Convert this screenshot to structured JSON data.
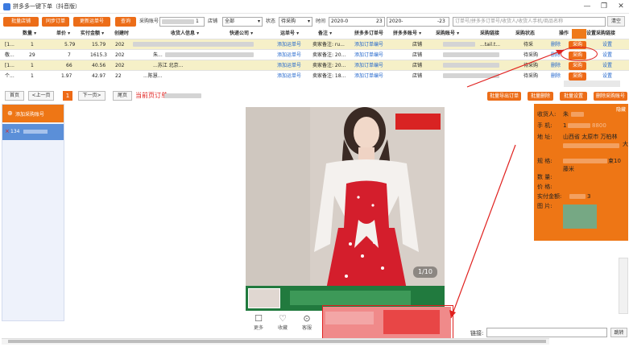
{
  "window": {
    "title": "拼多多一键下单（抖音版）",
    "min": "—",
    "max": "❐",
    "close": "✕"
  },
  "toolbar": {
    "btn1": "批量店铺",
    "btn2": "同步订单",
    "btn3": "更新运单号",
    "btn4": "查询",
    "purchase_account_label": "采购账号",
    "purchase_account_value": "1",
    "shop_label": "店铺",
    "shop_value": "全部",
    "status_label": "状态",
    "status_value": "待采购",
    "time_label": "时间",
    "date_from": "2020-0",
    "date_to_prefix": "23",
    "date_to": "2020-",
    "date_to_suffix": "-23",
    "search_placeholder": "订单号/拼多多订单号/收货人/收货人手机/商品名称",
    "clear_label": "清空",
    "search_label": "搜"
  },
  "table": {
    "headers": [
      "数量 ▾",
      "单价 ▾",
      "实付金额 ▾",
      "创建时",
      "收货人信息 ▾",
      "快递公司 ▾",
      "运单号 ▾",
      "备注 ▾",
      "拼多多订单号",
      "拼多多账号 ▾",
      "采购账号 ▾",
      "采购链接",
      "采购状态",
      "操作",
      "设置采购链接"
    ],
    "rows": [
      {
        "first": "[1...",
        "qty": "1",
        "unit": "5.79",
        "paid": "15.79",
        "created": "202",
        "receiver": "",
        "company": "",
        "waybill": "添加运单号",
        "note": "卖家备注: ru...",
        "pdd": "添加订单编号",
        "pdd_account": "店铺",
        "purchase_account": "",
        "link": "...tail.t...",
        "state": "待采",
        "op_del": "删除",
        "op_buy": "采购",
        "setting": "设置"
      },
      {
        "first": "敬...",
        "qty": "29",
        "unit": "7",
        "paid": "1615.3",
        "created": "202",
        "receiver": "朱...",
        "company": "",
        "waybill": "添加运单号",
        "note": "卖家备注: 20...",
        "pdd": "添加订单编号",
        "pdd_account": "店铺",
        "purchase_account": "",
        "link": "",
        "state": "待采购",
        "op_del": "删除",
        "op_buy": "采购",
        "setting": "设置"
      },
      {
        "first": "[1...",
        "qty": "1",
        "unit": "66",
        "paid": "40.56",
        "created": "202",
        "receiver": "...苏江 北京...",
        "company": "",
        "waybill": "添加运单号",
        "note": "卖家备注: 20...",
        "pdd": "添加订单编号",
        "pdd_account": "店铺",
        "purchase_account": "",
        "link": "",
        "state": "待采购",
        "op_del": "删除",
        "op_buy": "采购",
        "setting": "设置"
      },
      {
        "first": "个...",
        "qty": "1",
        "unit": "1.97",
        "paid": "42.97",
        "created": "22",
        "receiver": "...陈慧...",
        "company": "",
        "waybill": "添加运单号",
        "note": "卖家备注: 18...",
        "pdd": "添加订单编号",
        "pdd_account": "店铺",
        "purchase_account": "",
        "link": "",
        "state": "待采购",
        "op_del": "删除",
        "op_buy": "采购",
        "setting": "设置"
      }
    ]
  },
  "pager": {
    "first": "首页",
    "prev": "<上一页",
    "current": "1",
    "next": "下一页>",
    "last": "尾页",
    "page_note": "当前页订单",
    "right_btns": [
      "批量导出订单",
      "批量删除",
      "批量设置",
      "删除采购账号"
    ]
  },
  "left": {
    "add_label": "添加采购账号",
    "account": "134"
  },
  "product": {
    "counter": "1/10",
    "more": "更多",
    "fav": "收藏",
    "service": "客服"
  },
  "details": {
    "close": "隐藏",
    "receiver_label": "收货人:",
    "receiver_value": "朱",
    "phone_label": "手  机:",
    "phone_value": "1",
    "phone_suffix": "8800",
    "addr_label": "地  址:",
    "addr_value": "山西省 太原市 万柏林",
    "addr_tail": "大",
    "spec_label": "规  格:",
    "spec_value": "束10",
    "spec_line2": "藤米",
    "qty_label": "数  量:",
    "price_label": "价  格:",
    "paid_label": "实付金额:",
    "paid_value": "3",
    "img_label": "图  片:"
  },
  "link_bar": {
    "label": "链接:",
    "go": "跳转"
  }
}
